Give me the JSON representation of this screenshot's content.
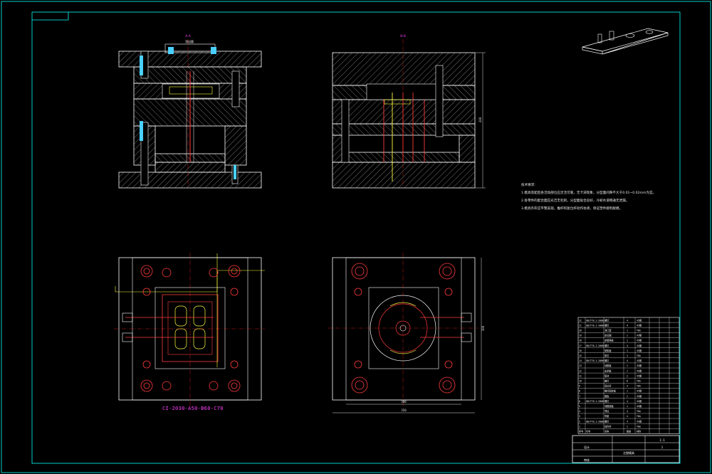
{
  "drawing": {
    "colors": {
      "background": "#000000",
      "frame": "#00ffff",
      "section_plate": "#ffffff",
      "hatch": "#c8c8c8",
      "component": "#ff3b3b",
      "centerline": "#ff2020",
      "cooling": "#ff40ff",
      "cavity": "#ffff40",
      "dimension": "#e0e0e0"
    },
    "section_a_title": "A—A",
    "section_b_title": "B—B",
    "section_a_note": "顶出版",
    "mold_base_code": "CI-2030-A50-B60-C70",
    "dim_width": "300",
    "dim_width_total": "350",
    "dim_height": "200",
    "dim_height_side": "300",
    "tech_requirements": {
      "title": "技术要求:",
      "items": [
        "1.模具装配后各活动部位应灵活可靠，无卡滞现象，分型面间隙不大于0.01~0.02mm为宜。",
        "2.各零件的配合面应光洁无毛刺，分型面贴合良好，冷却水道畅通无泄漏。",
        "3.模具外形应平整美观，推杆和复位杆动作协调，保证塑件顺利脱模。"
      ]
    },
    "bom_rows": [
      [
        "22",
        "GB/T70.1-2000",
        "螺钉",
        "4",
        "45钢"
      ],
      [
        "21",
        "GB/T70.1-2000",
        "螺钉",
        "4",
        "45钢"
      ],
      [
        "20",
        "",
        "浇口套",
        "1",
        "T8A"
      ],
      [
        "19",
        "",
        "定位圈",
        "1",
        "45钢"
      ],
      [
        "18",
        "",
        "定模座板",
        "1",
        "45钢"
      ],
      [
        "17",
        "GB/T70.1-2000",
        "螺钉",
        "4",
        "45钢"
      ],
      [
        "16",
        "",
        "型腔板",
        "1",
        "45钢"
      ],
      [
        "15",
        "",
        "型芯",
        "1",
        "T8A"
      ],
      [
        "14",
        "GB/T70.1-2000",
        "螺钉",
        "4",
        "45钢"
      ],
      [
        "13",
        "",
        "动模板",
        "1",
        "45钢"
      ],
      [
        "12",
        "",
        "支承板",
        "1",
        "45钢"
      ],
      [
        "11",
        "",
        "垫块",
        "2",
        "45钢"
      ],
      [
        "10",
        "",
        "推杆",
        "8",
        "T8A"
      ],
      [
        "9",
        "",
        "复位杆",
        "4",
        "T8A"
      ],
      [
        "8",
        "",
        "推杆固定板",
        "1",
        "45钢"
      ],
      [
        "7",
        "",
        "推板",
        "1",
        "45钢"
      ],
      [
        "6",
        "GB/T70.1-2000",
        "螺钉",
        "4",
        "45钢"
      ],
      [
        "5",
        "",
        "动模座板",
        "1",
        "45钢"
      ],
      [
        "4",
        "",
        "导柱",
        "4",
        "T8A"
      ],
      [
        "3",
        "",
        "导套",
        "4",
        "T8A"
      ],
      [
        "2",
        "GB/T70.1-2000",
        "螺钉",
        "4",
        "45钢"
      ],
      [
        "1",
        "",
        "拉料杆",
        "1",
        "T8A"
      ]
    ],
    "bom_header": [
      "序号",
      "代号",
      "名称",
      "数量",
      "材料"
    ],
    "title_block": {
      "name": "注塑模具",
      "scale": "1:1",
      "sheet": "1",
      "designer": "设计",
      "checker": "审核"
    }
  }
}
